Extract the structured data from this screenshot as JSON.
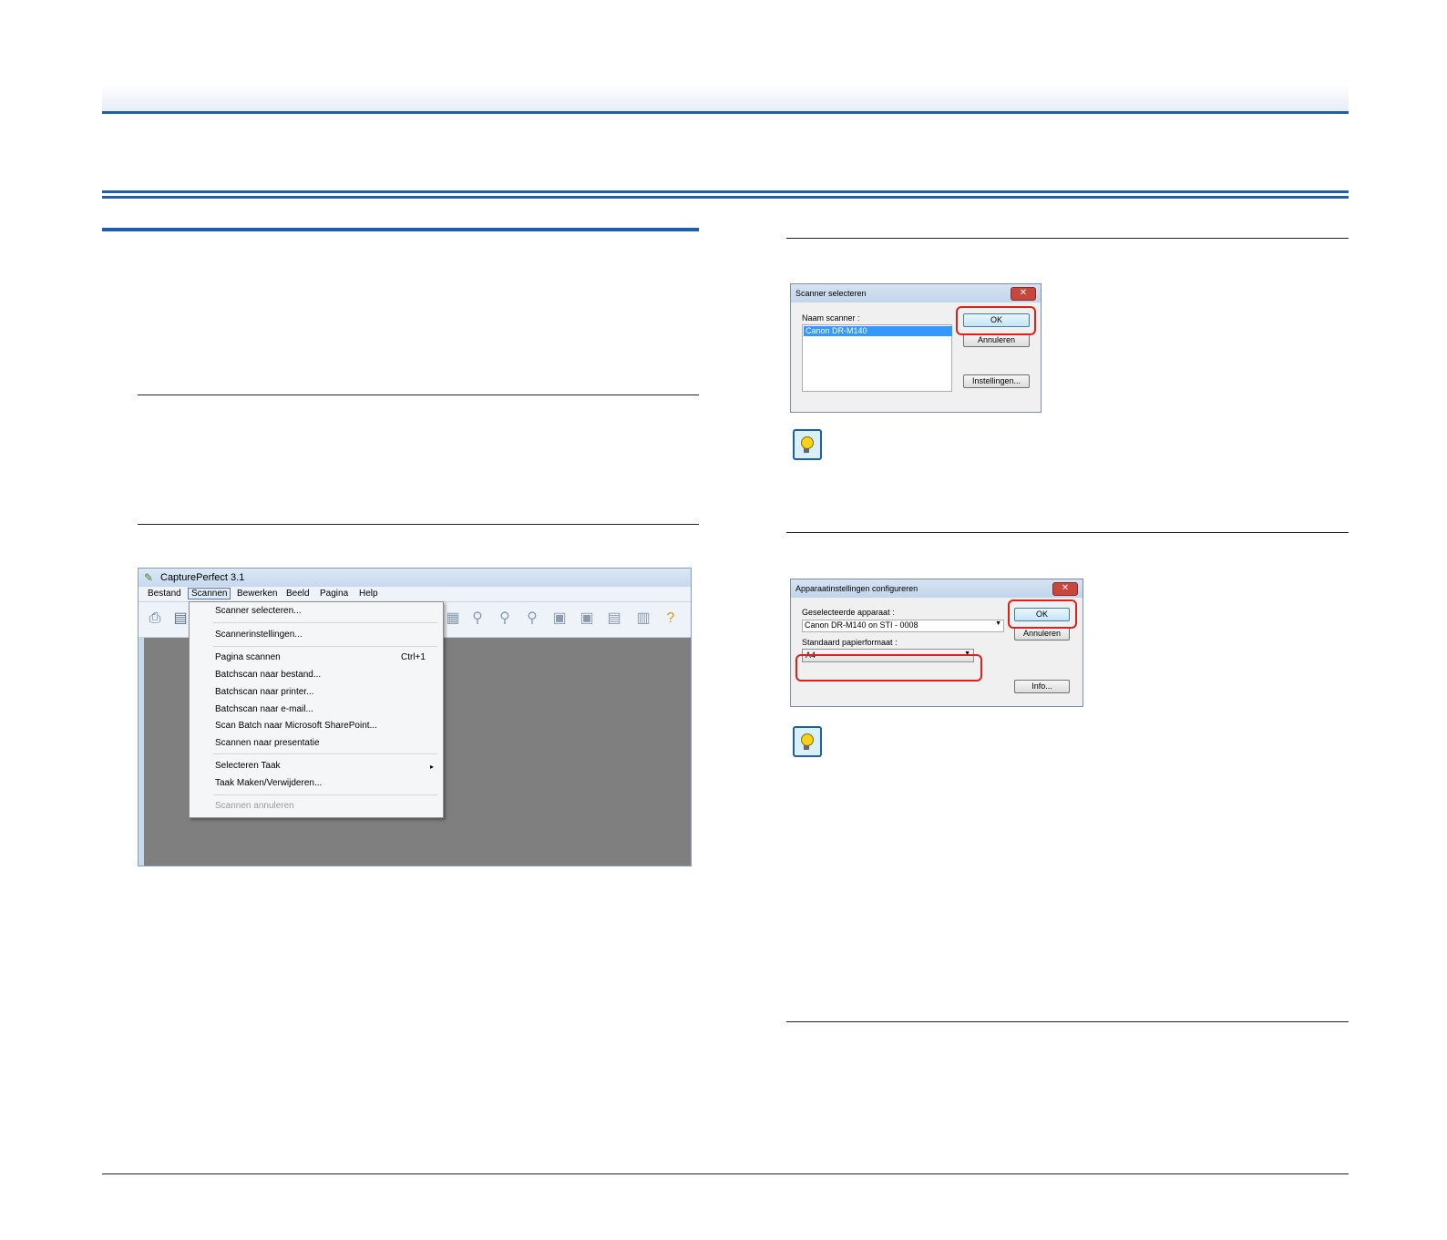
{
  "capture_window": {
    "title": "CapturePerfect 3.1",
    "menubar": [
      "Bestand",
      "Scannen",
      "Bewerken",
      "Beeld",
      "Pagina",
      "Help"
    ],
    "scan_menu": {
      "scanner_select": "Scanner selecteren...",
      "scanner_settings": "Scannerinstellingen...",
      "scan_page": "Pagina scannen",
      "scan_page_shortcut": "Ctrl+1",
      "batch_file": "Batchscan naar bestand...",
      "batch_printer": "Batchscan naar printer...",
      "batch_email": "Batchscan naar e-mail...",
      "batch_sharepoint": "Scan Batch naar Microsoft SharePoint...",
      "scan_presentation": "Scannen naar presentatie",
      "select_task": "Selecteren Taak",
      "task_create": "Taak Maken/Verwijderen...",
      "cancel_scan": "Scannen annuleren"
    }
  },
  "scanner_dialog": {
    "title": "Scanner selecteren",
    "name_label": "Naam scanner :",
    "selected_scanner": "Canon DR-M140",
    "ok": "OK",
    "cancel": "Annuleren",
    "settings": "Instellingen..."
  },
  "device_dialog": {
    "title": "Apparaatinstellingen configureren",
    "device_label": "Geselecteerde apparaat :",
    "device_value": "Canon DR-M140 on STI - 0008",
    "paper_label": "Standaard papierformaat :",
    "paper_value": "A4",
    "ok": "OK",
    "cancel": "Annuleren",
    "info": "Info..."
  }
}
